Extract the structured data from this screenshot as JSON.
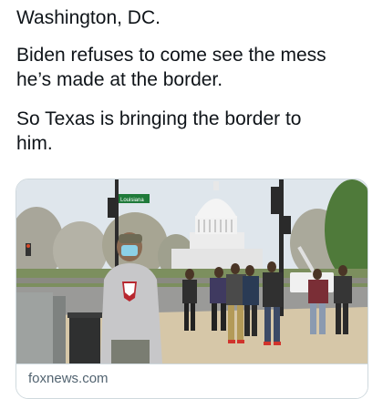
{
  "tweet": {
    "lines": [
      "Washington, DC.",
      "Biden refuses to come see the mess",
      "he’s made at the border.",
      "So Texas is bringing the border to",
      "him."
    ]
  },
  "link_card": {
    "domain": "foxnews.com",
    "street_sign": "LOUISIANA",
    "street_sign_prefix": "Louisiana"
  },
  "colors": {
    "text": "#0f1419",
    "secondary_text": "#536471",
    "border": "#cfd9de",
    "sky": "#dfe6ec",
    "sign_green": "#1f7a3a"
  }
}
